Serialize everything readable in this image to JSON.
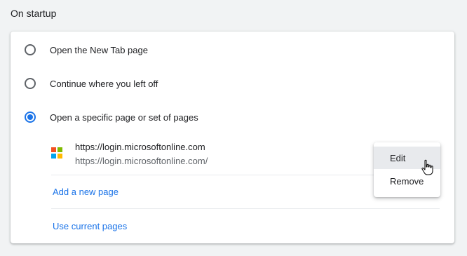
{
  "section": {
    "title": "On startup"
  },
  "options": [
    {
      "label": "Open the New Tab page",
      "checked": false
    },
    {
      "label": "Continue where you left off",
      "checked": false
    },
    {
      "label": "Open a specific page or set of pages",
      "checked": true
    }
  ],
  "pages": [
    {
      "icon": "microsoft-logo-icon",
      "title": "https://login.microsoftonline.com",
      "url": "https://login.microsoftonline.com/"
    }
  ],
  "actions": {
    "add_new_page": "Add a new page",
    "use_current_pages": "Use current pages"
  },
  "context_menu": {
    "edit": "Edit",
    "remove": "Remove"
  },
  "colors": {
    "accent": "#1a73e8",
    "ms_red": "#f25022",
    "ms_green": "#7fba00",
    "ms_blue": "#00a4ef",
    "ms_yellow": "#ffb900"
  }
}
